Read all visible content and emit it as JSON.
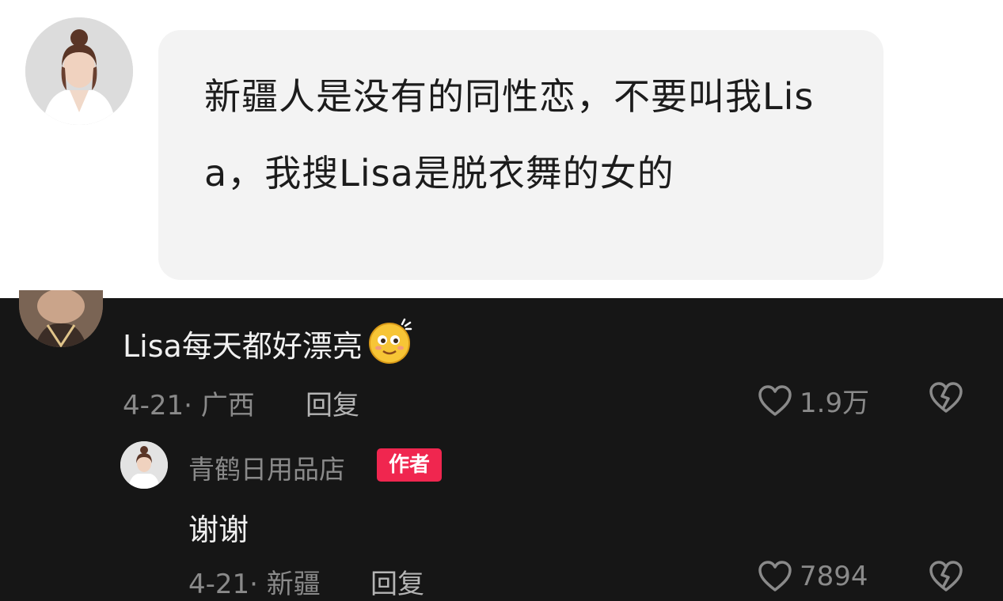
{
  "post": {
    "text": "新疆人是没有的同性恋，不要叫我Lisa，我搜Lisa是脱衣舞的女的"
  },
  "comments": [
    {
      "text": "Lisa每天都好漂亮",
      "emoji": "smiling-face-emoji",
      "date_location": "4-21· 广西",
      "reply_label": "回复",
      "likes": "1.9万",
      "replies": [
        {
          "username": "青鹤日用品店",
          "badge": "作者",
          "text": "谢谢",
          "date_location": "4-21· 新疆",
          "reply_label": "回复",
          "likes": "7894"
        }
      ]
    }
  ],
  "icons": {
    "like": "heart-icon",
    "dislike": "broken-heart-icon"
  },
  "colors": {
    "badge": "#f0264f",
    "background": "#161616"
  }
}
